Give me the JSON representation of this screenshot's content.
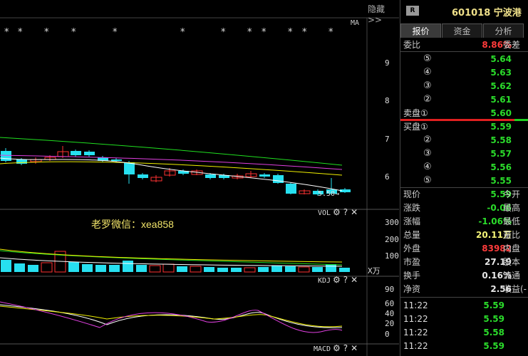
{
  "toolbar": {
    "hide_label": "隐藏>>"
  },
  "main_chart": {
    "indicator": "MA",
    "y_ticks": [
      "9",
      "8",
      "7",
      "6"
    ],
    "last_price_tag": "5.50→",
    "colors": {
      "up": "#ff3232",
      "down": "#27e0f0",
      "ma5": "#ffffff",
      "ma10": "#f0f000",
      "ma20": "#e040e0",
      "ma60": "#20e020"
    }
  },
  "watermark": "老罗微信：xea858",
  "volume_panel": {
    "title": "VOL",
    "y_ticks": [
      "300",
      "200",
      "100"
    ],
    "unit": "X万"
  },
  "kdj_panel": {
    "title": "KDJ",
    "y_ticks": [
      "90",
      "60",
      "40",
      "20",
      "0"
    ]
  },
  "macd_panel": {
    "title": "MACD"
  },
  "quote": {
    "badge": "R",
    "code_name": "601018 宁波港",
    "tabs": [
      "报价",
      "资金",
      "分析"
    ],
    "ratio": {
      "label": "委比",
      "value": "8.86%",
      "label2": "委差"
    },
    "sell": [
      {
        "level": "⑤",
        "price": "5.64"
      },
      {
        "level": "④",
        "price": "5.63"
      },
      {
        "level": "③",
        "price": "5.62"
      },
      {
        "level": "②",
        "price": "5.61"
      },
      {
        "level": "卖盘①",
        "price": "5.60"
      }
    ],
    "buy": [
      {
        "level": "买盘①",
        "price": "5.59"
      },
      {
        "level": "②",
        "price": "5.58"
      },
      {
        "level": "③",
        "price": "5.57"
      },
      {
        "level": "④",
        "price": "5.56"
      },
      {
        "level": "⑤",
        "price": "5.55"
      }
    ],
    "stats": [
      {
        "label": "现价",
        "value": "5.59",
        "label2": "今开",
        "color": "green"
      },
      {
        "label": "涨跌",
        "value": "-0.06",
        "label2": "最高",
        "color": "green"
      },
      {
        "label": "涨幅",
        "value": "-1.06%",
        "label2": "最低",
        "color": "green"
      },
      {
        "label": "总量",
        "value": "20.11万",
        "label2": "量比",
        "color": "yellow"
      },
      {
        "label": "外盘",
        "value": "83982",
        "label2": "内盘",
        "color": "red"
      },
      {
        "label": "市盈",
        "value": "27.19",
        "label2": "股本",
        "color": "white"
      },
      {
        "label": "换手",
        "value": "0.16%",
        "label2": "流通",
        "color": "white"
      },
      {
        "label": "净资",
        "value": "2.56",
        "label2": "收益(-",
        "color": "white"
      }
    ],
    "trades": [
      {
        "time": "11:22",
        "price": "5.59"
      },
      {
        "time": "11:22",
        "price": "5.59"
      },
      {
        "time": "11:22",
        "price": "5.58"
      },
      {
        "time": "11:22",
        "price": "5.59"
      }
    ]
  }
}
